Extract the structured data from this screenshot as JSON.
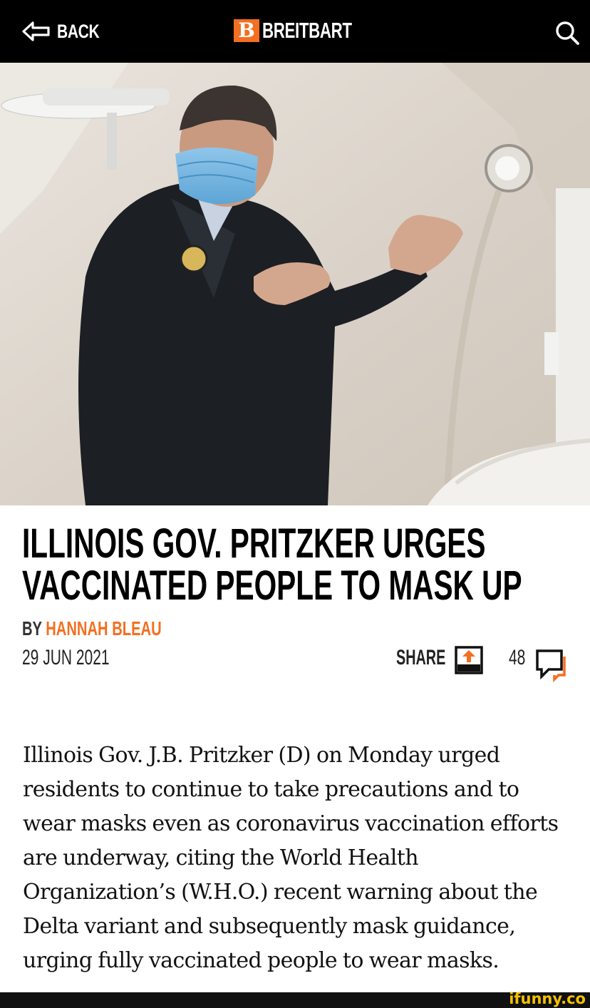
{
  "header": {
    "back_label": "BACK",
    "brand_letter": "B",
    "brand_name": "BREITBART",
    "brand_color": "#f36f21",
    "search_icon": "search-icon"
  },
  "article": {
    "headline_lines": [
      "ILLINOIS GOV. PRITZKER URGES",
      "VACCINATED PEOPLE TO MASK UP"
    ],
    "by_prefix": "BY",
    "author": "HANNAH BLEAU",
    "date": "29 JUN 2021",
    "share_label": "SHARE",
    "comment_count": "48",
    "body_lines": [
      "Illinois Gov. J.B. Pritzker (D) on Monday urged",
      "residents to continue to take precautions and to",
      "wear masks even as coronavirus vaccination efforts",
      "are underway, citing the World Health",
      "Organization’s (W.H.O.) recent warning about the",
      "Delta variant and subsequently mask guidance,",
      "urging fully vaccinated people to wear masks."
    ]
  },
  "watermark": "ifunny.co"
}
